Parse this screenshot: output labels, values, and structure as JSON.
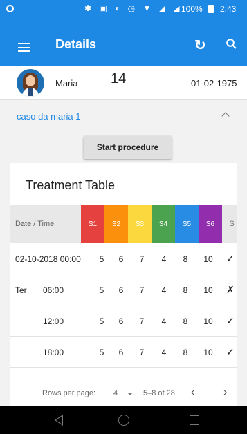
{
  "statusbar": {
    "icons": "✱ ▣ ◐ ◷ ▼ ◢ ◢",
    "battery": "100%",
    "time": "2:43"
  },
  "appbar": {
    "title": "Details"
  },
  "patient": {
    "name": "Maria",
    "number": "14",
    "birthdate": "01-02-1975"
  },
  "case": {
    "title": "caso da maria 1"
  },
  "start_button": {
    "label": "Start procedure"
  },
  "table": {
    "title": "Treatment Table",
    "header": {
      "date": "Date / Time",
      "s": "S"
    },
    "columns": [
      {
        "label": "S1",
        "color": "#e53935"
      },
      {
        "label": "S2",
        "color": "#fb8c00"
      },
      {
        "label": "S3",
        "color": "#fdd835"
      },
      {
        "label": "S4",
        "color": "#43a047"
      },
      {
        "label": "S5",
        "color": "#1e88e5"
      },
      {
        "label": "S6",
        "color": "#8e24aa"
      }
    ],
    "rows": [
      {
        "day": "",
        "time": "02-10-2018 00:00",
        "values": [
          "5",
          "6",
          "7",
          "4",
          "8",
          "10"
        ],
        "status": "✓"
      },
      {
        "day": "Ter",
        "time": "06:00",
        "values": [
          "5",
          "6",
          "7",
          "4",
          "8",
          "10"
        ],
        "status": "✗"
      },
      {
        "day": "",
        "time": "12:00",
        "values": [
          "5",
          "6",
          "7",
          "4",
          "8",
          "10"
        ],
        "status": "✓"
      },
      {
        "day": "",
        "time": "18:00",
        "values": [
          "5",
          "6",
          "7",
          "4",
          "8",
          "10"
        ],
        "status": "✓"
      }
    ],
    "footer": {
      "rows_per_page_label": "Rows per page:",
      "rows_per_page": "4",
      "range": "5–8 of 28"
    }
  }
}
